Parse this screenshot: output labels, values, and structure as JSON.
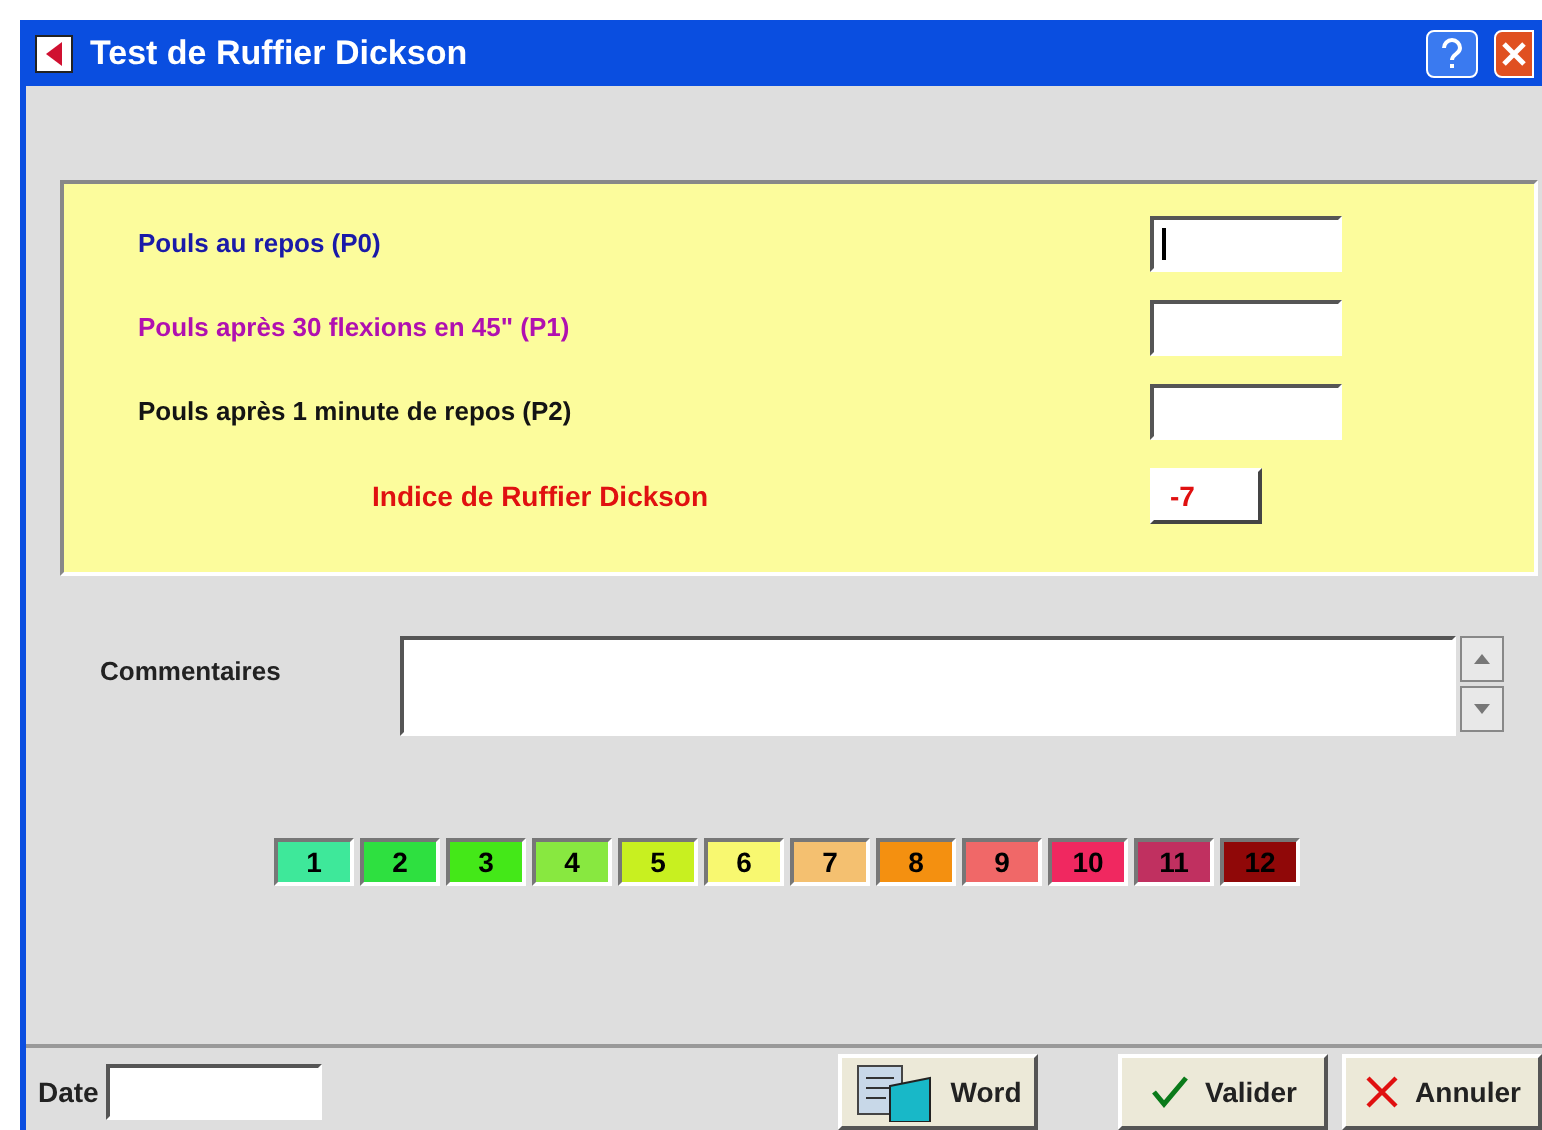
{
  "window": {
    "title": "Test de Ruffier Dickson"
  },
  "fields": [
    {
      "label": "Pouls au repos (P0)",
      "color": "#1a1aa8",
      "focused": true
    },
    {
      "label": "Pouls après 30 flexions en 45\" (P1)",
      "color": "#b010b0",
      "focused": false
    },
    {
      "label": "Pouls après 1 minute de repos (P2)",
      "color": "#141414",
      "focused": false
    }
  ],
  "index": {
    "label": "Indice de Ruffier Dickson",
    "value": "-7"
  },
  "comments": {
    "label": "Commentaires"
  },
  "scale": [
    {
      "label": "1",
      "color": "#3ee89a"
    },
    {
      "label": "2",
      "color": "#2ee040"
    },
    {
      "label": "3",
      "color": "#44e818"
    },
    {
      "label": "4",
      "color": "#88e840"
    },
    {
      "label": "5",
      "color": "#c8f020"
    },
    {
      "label": "6",
      "color": "#f8f870"
    },
    {
      "label": "7",
      "color": "#f4c070"
    },
    {
      "label": "8",
      "color": "#f49010"
    },
    {
      "label": "9",
      "color": "#f06868"
    },
    {
      "label": "10",
      "color": "#f02860"
    },
    {
      "label": "11",
      "color": "#c03060"
    },
    {
      "label": "12",
      "color": "#900808"
    }
  ],
  "footer": {
    "date_label": "Date",
    "buttons": [
      {
        "kind": "word",
        "label": "Word"
      },
      {
        "kind": "ok",
        "label": "Valider"
      },
      {
        "kind": "cancel",
        "label": "Annuler"
      }
    ]
  }
}
